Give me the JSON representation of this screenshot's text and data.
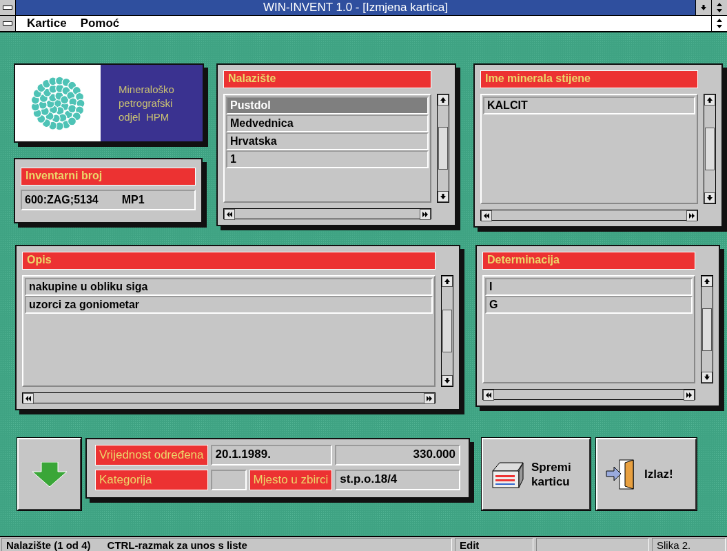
{
  "window": {
    "title": "WIN-INVENT 1.0 - [Izmjena kartica]"
  },
  "menu": [
    {
      "label": "Kartice"
    },
    {
      "label": "Pomoć"
    }
  ],
  "logo": {
    "lines": [
      "Mineraloško",
      "petrografski",
      "odjel  HPM"
    ]
  },
  "inventory": {
    "label": "Inventarni broj",
    "value": "600:ZAG;5134",
    "suffix": "MP1"
  },
  "lists": [
    {
      "title": "Nalazište",
      "items": [
        {
          "text": "Pustdol",
          "selected": true
        },
        {
          "text": "Medvednica",
          "selected": false
        },
        {
          "text": "Hrvatska",
          "selected": false
        },
        {
          "text": "1",
          "selected": false
        }
      ]
    },
    {
      "title": "Ime minerala stijene",
      "items": [
        {
          "text": "KALCIT",
          "selected": false
        }
      ]
    },
    {
      "title": "Opis",
      "items": [
        {
          "text": "nakupine u obliku siga",
          "selected": false
        },
        {
          "text": "uzorci za goniometar",
          "selected": false
        }
      ]
    },
    {
      "title": "Determinacija",
      "items": [
        {
          "text": "I",
          "selected": false
        },
        {
          "text": "G",
          "selected": false
        }
      ]
    }
  ],
  "details": {
    "value_label": "Vrijednost određena",
    "date": "20.1.1989.",
    "amount": "330.000",
    "category_label": "Kategorija",
    "location_label": "Mjesto u zbirci",
    "location": "st.p.o.18/4"
  },
  "buttons": [
    {
      "kind": "save",
      "label": "Spremi",
      "label_2": "karticu"
    },
    {
      "kind": "exit",
      "label": "Izlaz!"
    }
  ],
  "status_bar": {
    "message": "Nalazište (1 od 4)",
    "hint": "CTRL-razmak za unos s liste",
    "mode": "Edit",
    "caption": "Slika 2."
  }
}
